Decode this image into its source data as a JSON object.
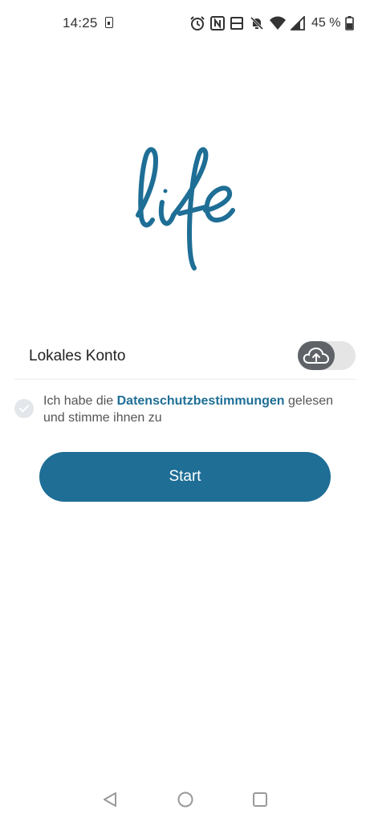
{
  "status_bar": {
    "time": "14:25",
    "battery_percent": "45 %",
    "icons": [
      "sim-icon",
      "alarm-icon",
      "nfc-icon",
      "volte-icon",
      "mute-icon",
      "wifi-icon",
      "signal-icon",
      "battery-icon"
    ]
  },
  "logo": {
    "name": "life-logo",
    "color": "#1e6e96"
  },
  "account": {
    "label": "Lokales Konto",
    "cloud_sync_enabled": false
  },
  "consent": {
    "prefix": "Ich habe die ",
    "link": "Datenschutzbestimmungen",
    "suffix": " gelesen und stimme ihnen zu",
    "checked": false
  },
  "start_button": {
    "label": "Start"
  },
  "colors": {
    "accent": "#1e6e96",
    "toggle_knob": "#5f6368",
    "toggle_track": "#e5e5e5"
  }
}
